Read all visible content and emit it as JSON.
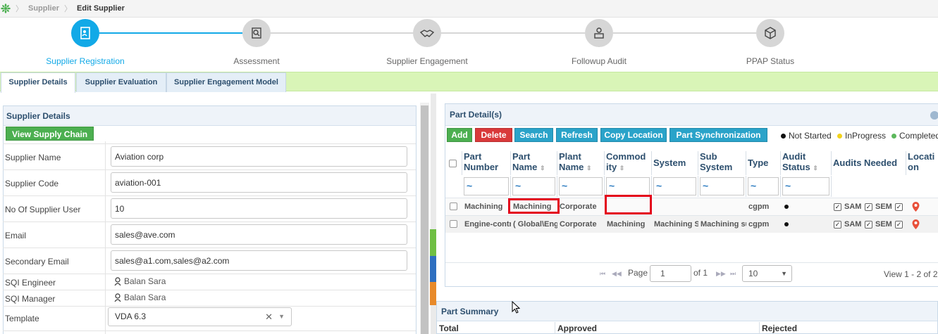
{
  "breadcrumb": {
    "logo_icon": "app-logo-icon",
    "items": [
      "Supplier",
      "Edit Supplier"
    ]
  },
  "stepper": {
    "active_color": "#12a9e7",
    "steps": [
      {
        "label": "Supplier Registration",
        "icon": "registration-icon",
        "state": "active"
      },
      {
        "label": "Assessment",
        "icon": "assessment-icon",
        "state": "inactive"
      },
      {
        "label": "Supplier Engagement",
        "icon": "handshake-icon",
        "state": "inactive"
      },
      {
        "label": "Followup Audit",
        "icon": "audit-icon",
        "state": "inactive"
      },
      {
        "label": "PPAP Status",
        "icon": "cube-icon",
        "state": "inactive"
      }
    ]
  },
  "tabs": [
    {
      "label": "Supplier Details",
      "active": true
    },
    {
      "label": "Supplier Evaluation",
      "active": false
    },
    {
      "label": "Supplier Engagement Model",
      "active": false
    }
  ],
  "supplier_details": {
    "title": "Supplier Details",
    "view_chain_button": "View Supply Chain",
    "fields": [
      {
        "label": "Supplier Name",
        "value": "Aviation corp"
      },
      {
        "label": "Supplier Code",
        "value": "aviation-001"
      },
      {
        "label": "No Of Supplier User",
        "value": "10"
      },
      {
        "label": "Email",
        "value": "sales@ave.com"
      },
      {
        "label": "Secondary Email",
        "value": "sales@a1.com,sales@a2.com"
      }
    ],
    "sqi_engineer": {
      "label": "SQI Engineer",
      "value": "Balan Sara"
    },
    "sqi_manager": {
      "label": "SQI Manager",
      "value": "Balan Sara"
    },
    "template": {
      "label": "Template",
      "value": "VDA 6.3"
    }
  },
  "part_details": {
    "title": "Part Detail(s)",
    "buttons": {
      "add": "Add",
      "delete": "Delete",
      "search": "Search",
      "refresh": "Refresh",
      "copy_location": "Copy Location",
      "part_sync": "Part Synchronization"
    },
    "button_colors": {
      "add": "#4caf50",
      "delete": "#d9393a",
      "search": "#2aa3c9",
      "refresh": "#2aa3c9",
      "copy_location": "#2aa3c9",
      "part_sync": "#2aa3c9"
    },
    "legend": [
      {
        "label": "Not Started",
        "color": "#111111"
      },
      {
        "label": "InProgress",
        "color": "#f2d21b"
      },
      {
        "label": "Completed",
        "color": "#5cb85c"
      }
    ],
    "columns": {
      "part_number": [
        "Part",
        "Number"
      ],
      "part_name": [
        "Part",
        "Name"
      ],
      "plant_name": [
        "Plant",
        "Name"
      ],
      "commodity": [
        "Commod",
        "ity"
      ],
      "system": "System",
      "sub_system": [
        "Sub",
        "System"
      ],
      "type": "Type",
      "audit_status": [
        "Audit",
        "Status"
      ],
      "audits_needed": "Audits Needed",
      "location": [
        "Locati",
        "on"
      ]
    },
    "filter_symbol": "~",
    "rows": [
      {
        "part_number": "Machining",
        "part_name": "Machining",
        "plant_name": "Corporate",
        "commodity": "",
        "system": "",
        "sub_system": "",
        "type": "cgpm",
        "audits": [
          "SAM",
          "SEM"
        ]
      },
      {
        "part_number": "Engine-control",
        "part_name": "( Global\\Engine",
        "plant_name": "Corporate",
        "commodity": "Machining",
        "system": "Machining Systems",
        "sub_system": "Machining sub",
        "type": "cgpm",
        "audits": [
          "SAM",
          "SEM"
        ]
      }
    ],
    "pager": {
      "page_label": "Page",
      "page_value": "1",
      "of_label": "of 1",
      "page_size": "10",
      "view_text": "View 1 - 2 of 2"
    }
  },
  "part_summary": {
    "title": "Part Summary",
    "columns": [
      "Total",
      "Approved",
      "Rejected"
    ]
  }
}
